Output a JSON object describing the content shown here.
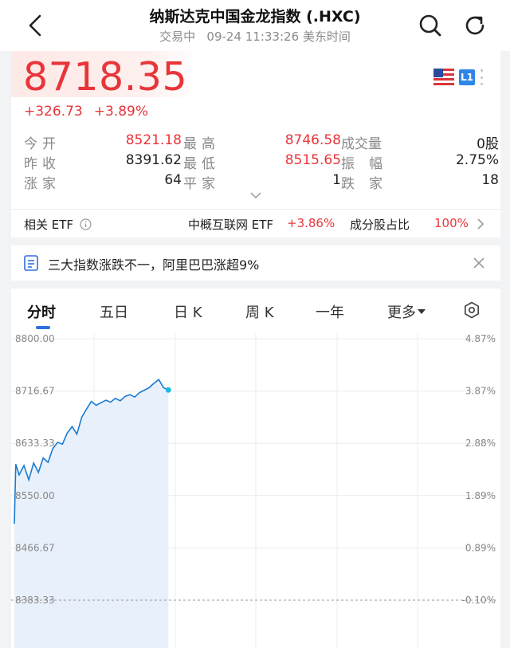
{
  "header": {
    "title": "纳斯达克中国金龙指数 (.HXC)",
    "subtitle": "交易中   09-24 11:33:26 美东时间"
  },
  "quote": {
    "price": "8718.35",
    "change": "+326.73",
    "change_pct": "+3.89%",
    "level_badge": "L1",
    "stats": [
      [
        {
          "label": "今开",
          "value": "8521.18",
          "red": true
        },
        {
          "label": "最高",
          "value": "8746.58",
          "red": true
        },
        {
          "label": "成交量",
          "value": "0股",
          "red": false
        }
      ],
      [
        {
          "label": "昨收",
          "value": "8391.62",
          "red": false
        },
        {
          "label": "最低",
          "value": "8515.65",
          "red": true
        },
        {
          "label": "振幅",
          "value": "2.75%",
          "red": false
        }
      ],
      [
        {
          "label": "涨家",
          "value": "64",
          "red": false
        },
        {
          "label": "平家",
          "value": "1",
          "red": false
        },
        {
          "label": "跌家",
          "value": "18",
          "red": false
        }
      ]
    ]
  },
  "etf": {
    "label": "相关 ETF",
    "name": "中概互联网 ETF",
    "pct": "+3.86%",
    "ratio_label": "成分股占比",
    "ratio": "100%"
  },
  "news": {
    "text": "三大指数涨跌不一，阿里巴巴涨超9%"
  },
  "tabs": [
    "分时",
    "五日",
    "日 K",
    "周 K",
    "一年",
    "更多"
  ],
  "colors": {
    "up": "#e8353a",
    "line": "#1a7ad0",
    "fill": "#e8f0fb",
    "accent": "#2f6fe0"
  },
  "chart_data": {
    "type": "area",
    "y_left_ticks": [
      "8800.00",
      "8716.67",
      "8633.33",
      "8550.00",
      "8466.67",
      "8383.33"
    ],
    "y_right_ticks": [
      "4.87%",
      "3.87%",
      "2.88%",
      "1.89%",
      "0.89%",
      "-0.10%"
    ],
    "ylim": [
      8383.33,
      8800.0
    ],
    "x_session_fraction_shown": 0.32,
    "x": [
      0,
      0.003,
      0.01,
      0.02,
      0.03,
      0.04,
      0.05,
      0.06,
      0.07,
      0.08,
      0.09,
      0.1,
      0.11,
      0.12,
      0.13,
      0.14,
      0.15,
      0.16,
      0.17,
      0.18,
      0.19,
      0.2,
      0.21,
      0.22,
      0.23,
      0.24,
      0.25,
      0.26,
      0.27,
      0.28,
      0.29,
      0.3,
      0.31,
      0.32
    ],
    "values": [
      8505,
      8600,
      8583,
      8598,
      8575,
      8602,
      8587,
      8610,
      8603,
      8625,
      8635,
      8632,
      8650,
      8660,
      8648,
      8675,
      8688,
      8700,
      8694,
      8698,
      8702,
      8699,
      8705,
      8701,
      8708,
      8711,
      8707,
      8714,
      8718,
      8722,
      8729,
      8735,
      8722,
      8718.35
    ]
  }
}
